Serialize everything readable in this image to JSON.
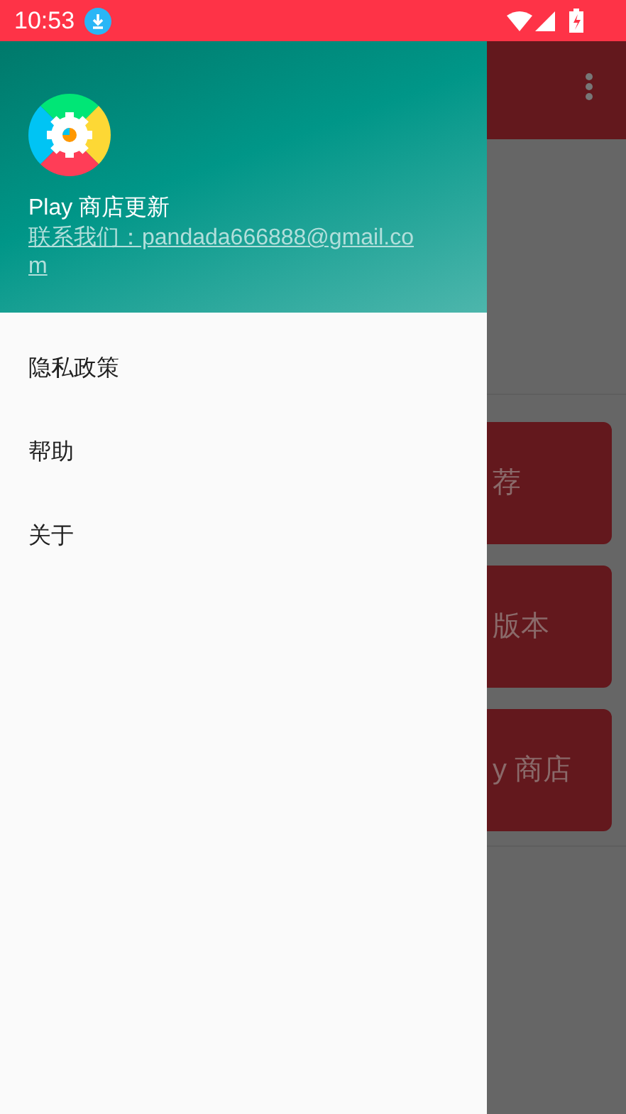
{
  "status_bar": {
    "time": "10:53"
  },
  "drawer": {
    "app_name": "Play 商店更新",
    "contact": "联系我们：pandada666888@gmail.com",
    "items": [
      {
        "label": "隐私政策"
      },
      {
        "label": "帮助"
      },
      {
        "label": "关于"
      }
    ]
  },
  "background": {
    "buttons": [
      {
        "label": "荐"
      },
      {
        "label": "版本"
      },
      {
        "label": "y 商店"
      }
    ]
  }
}
